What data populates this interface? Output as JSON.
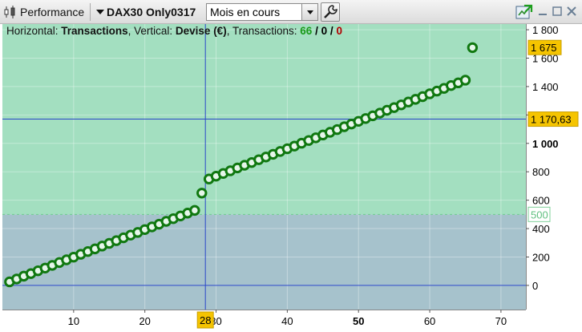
{
  "toolbar": {
    "panel_title": "Performance",
    "instrument": "DAX30 Only0317",
    "period_select": {
      "value": "Mois en cours"
    }
  },
  "info": {
    "horizontal_label": "Horizontal:",
    "horizontal_value": "Transactions",
    "vertical_label": "Vertical:",
    "vertical_value": "Devise (€)",
    "transactions_label": "Transactions:",
    "count_green": "66",
    "count_black": "0",
    "count_red": "0",
    "separator": "/"
  },
  "chart_data": {
    "type": "scatter",
    "x_ticks": [
      "10",
      "20",
      "30",
      "40",
      "50",
      "60",
      "70"
    ],
    "x_bold_tick": "50",
    "y_ticks": [
      "0",
      "200",
      "400",
      "600",
      "800",
      "1 000",
      "1 200",
      "1 400",
      "1 600",
      "1 800"
    ],
    "y_bold_tick": "1 000",
    "xlim": [
      0,
      73.5
    ],
    "ylim": [
      -170,
      1840
    ],
    "markers": {
      "last_value": "1 675",
      "crosshair_y": "1 170,63",
      "crosshair_x": "28",
      "threshold": "500"
    },
    "crosshair": {
      "x": 28.5,
      "y": 1170.63
    },
    "threshold_value": 500,
    "colors": {
      "gain_zone": "#a3dfc0",
      "loss_zone": "#a6c2cc",
      "marker_stroke": "#107810",
      "crosshair": "#2a46c8",
      "badge": "#f5c400"
    },
    "x": [
      1,
      2,
      3,
      4,
      5,
      6,
      7,
      8,
      9,
      10,
      11,
      12,
      13,
      14,
      15,
      16,
      17,
      18,
      19,
      20,
      21,
      22,
      23,
      24,
      25,
      26,
      27,
      28,
      29,
      30,
      31,
      32,
      33,
      34,
      35,
      36,
      37,
      38,
      39,
      40,
      41,
      42,
      43,
      44,
      45,
      46,
      47,
      48,
      49,
      50,
      51,
      52,
      53,
      54,
      55,
      56,
      57,
      58,
      59,
      60,
      61,
      62,
      63,
      64,
      65,
      66
    ],
    "y": [
      25,
      45,
      65,
      83,
      103,
      122,
      141,
      161,
      180,
      199,
      219,
      238,
      257,
      277,
      296,
      315,
      335,
      354,
      373,
      393,
      412,
      431,
      451,
      470,
      489,
      509,
      528,
      650,
      749,
      769,
      788,
      807,
      827,
      846,
      865,
      885,
      904,
      923,
      943,
      962,
      981,
      1001,
      1020,
      1039,
      1059,
      1078,
      1097,
      1117,
      1136,
      1155,
      1175,
      1194,
      1213,
      1233,
      1252,
      1271,
      1291,
      1310,
      1329,
      1349,
      1368,
      1387,
      1407,
      1426,
      1445,
      1674
    ]
  }
}
